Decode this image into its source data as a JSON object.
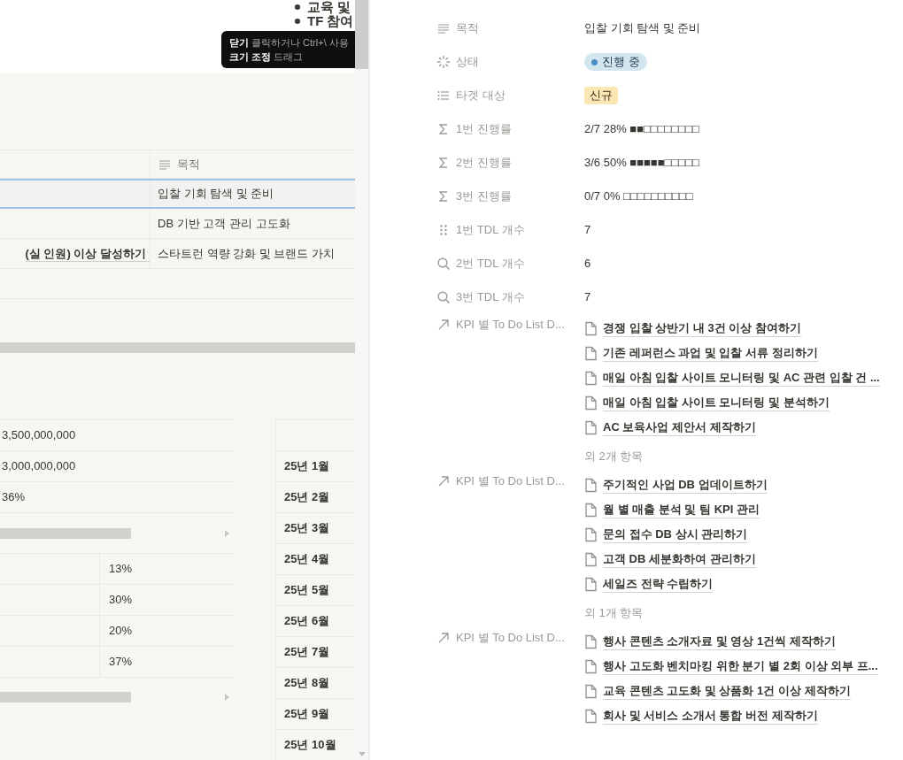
{
  "page_bullets": [
    "교육 및",
    "TF 참여"
  ],
  "tooltip": {
    "lines": [
      "**닫기** 클릭하거나 Ctrl+\\ 사용",
      "**크기 조정** 드래그"
    ]
  },
  "goal_table": {
    "column_2_header": "목적",
    "rows": [
      {
        "column_2": "입찰 기회 탐색 및 준비",
        "selected": true
      },
      {
        "column_2": "DB 기반 고객 관리 고도화",
        "selected": false
      },
      {
        "column_1": "(실 인원) 이상 달성하기",
        "column_2": "스타트런 역량 강화 및 브랜드 가치",
        "selected": false
      }
    ]
  },
  "amount_table": {
    "rows": [
      "3,500,000,000",
      "3,000,000,000",
      "36%"
    ]
  },
  "share_table": {
    "rows": [
      "13%",
      "30%",
      "20%",
      "37%"
    ]
  },
  "month_table": {
    "rows": [
      "25년 1월",
      "25년 2월",
      "25년 3월",
      "25년 4월",
      "25년 5월",
      "25년 6월",
      "25년 7월",
      "25년 8월",
      "25년 9월",
      "25년 10월"
    ]
  },
  "properties": [
    {
      "kind": "text",
      "label": "목적",
      "value": "입찰 기회 탐색 및 준비"
    },
    {
      "kind": "status",
      "label": "상태",
      "value": "진행 중",
      "color": "#4d8fc4"
    },
    {
      "kind": "select",
      "label": "타겟 대상",
      "value": "신규",
      "color": "#fbe7b3"
    },
    {
      "kind": "formula",
      "label": "1번 진행률",
      "value": "2/7 28% ■■□□□□□□□□"
    },
    {
      "kind": "formula",
      "label": "2번 진행률",
      "value": "3/6 50% ■■■■■□□□□□"
    },
    {
      "kind": "formula",
      "label": "3번 진행률",
      "value": "0/7 0% □□□□□□□□□□"
    },
    {
      "kind": "count",
      "label": "1번 TDL 개수",
      "value": "7"
    },
    {
      "kind": "rollup",
      "label": "2번 TDL 개수",
      "value": "6"
    },
    {
      "kind": "rollup",
      "label": "3번 TDL 개수",
      "value": "7"
    },
    {
      "kind": "relation",
      "label": "KPI 별 To Do List D...",
      "items": [
        "경쟁 입찰 상반기 내 3건 이상 참여하기",
        "기존 레퍼런스 과업 및 입찰 서류 정리하기",
        "매일 아침 입찰 사이트 모니터링 및 AC 관련 입찰 건 ...",
        "매일 아침 입찰 사이트 모니터링 및 분석하기",
        "AC 보육사업 제안서 제작하기"
      ],
      "more": "외 2개 항목"
    },
    {
      "kind": "relation",
      "label": "KPI 별 To Do List D...",
      "items": [
        "주기적인 사업 DB 업데이트하기",
        "월 별 매출 분석 및 팀 KPI 관리",
        "문의 접수 DB 상시 관리하기",
        "고객 DB 세분화하여 관리하기",
        "세일즈 전략 수립하기"
      ],
      "more": "외 1개 항목"
    },
    {
      "kind": "relation",
      "label": "KPI 별 To Do List D...",
      "items": [
        "행사 콘텐츠 소개자료 및 영상 1건씩 제작하기",
        "행사 고도화 벤치마킹 위한 분기 별 2회 이상 외부 프...",
        "교육 콘텐츠 고도화 및 상품화 1건 이상 제작하기",
        "회사 및 서비스 소개서 통합 버전 제작하기"
      ]
    }
  ]
}
